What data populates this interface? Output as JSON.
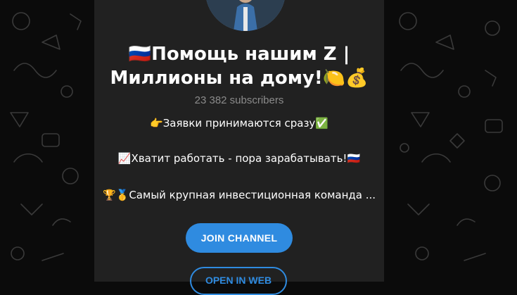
{
  "channel": {
    "title_line1": "🇷🇺Помощь нашим Z |",
    "title_line2": "Миллионы на дому!🍋💰",
    "subscribers": "23 382 subscribers",
    "description": [
      "👉Заявки принимаются сразу✅",
      "📈Хватит работать - пора зарабатывать!🇷🇺",
      "🏆🥇Самый крупная инвестиционная команда ..."
    ]
  },
  "buttons": {
    "join": "JOIN CHANNEL",
    "open_web": "OPEN IN WEB"
  },
  "colors": {
    "accent": "#2f8be0",
    "card": "#212121",
    "background": "#0b0b0b",
    "muted_text": "#8b8b8b"
  }
}
